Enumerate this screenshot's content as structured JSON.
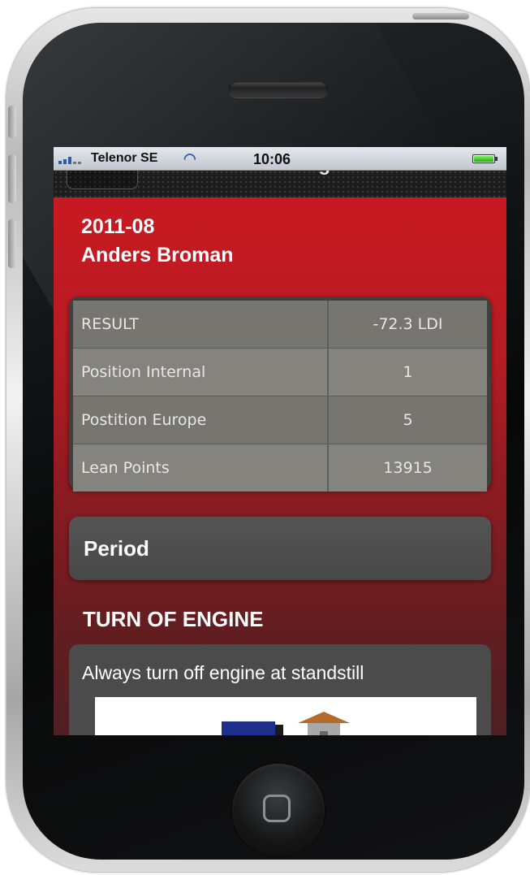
{
  "status_bar": {
    "carrier": "Telenor SE",
    "time": "10:06",
    "signal_icon": "signal-bars-icon",
    "wifi_icon": "wifi-icon",
    "battery_icon": "battery-icon",
    "battery_level": 1.0
  },
  "nav_bar": {
    "title": "Ecodriving",
    "back_button_icon": "back-button"
  },
  "header": {
    "period": "2011-08",
    "user": "Anders Broman"
  },
  "stats": [
    {
      "label": "RESULT",
      "value": "-72.3 LDI"
    },
    {
      "label": "Position Internal",
      "value": "1"
    },
    {
      "label": "Postition Europe",
      "value": "5"
    },
    {
      "label": "Lean Points",
      "value": "13915"
    }
  ],
  "period_button": {
    "label": "Period"
  },
  "tip": {
    "title": "TURN OF ENGINE",
    "text": "Always turn off engine at standstill",
    "image_icon": "truck-at-building-illustration"
  },
  "colors": {
    "accent_red": "#c91922",
    "card_gray": "#4b4b4b",
    "table_row": "#767570"
  }
}
